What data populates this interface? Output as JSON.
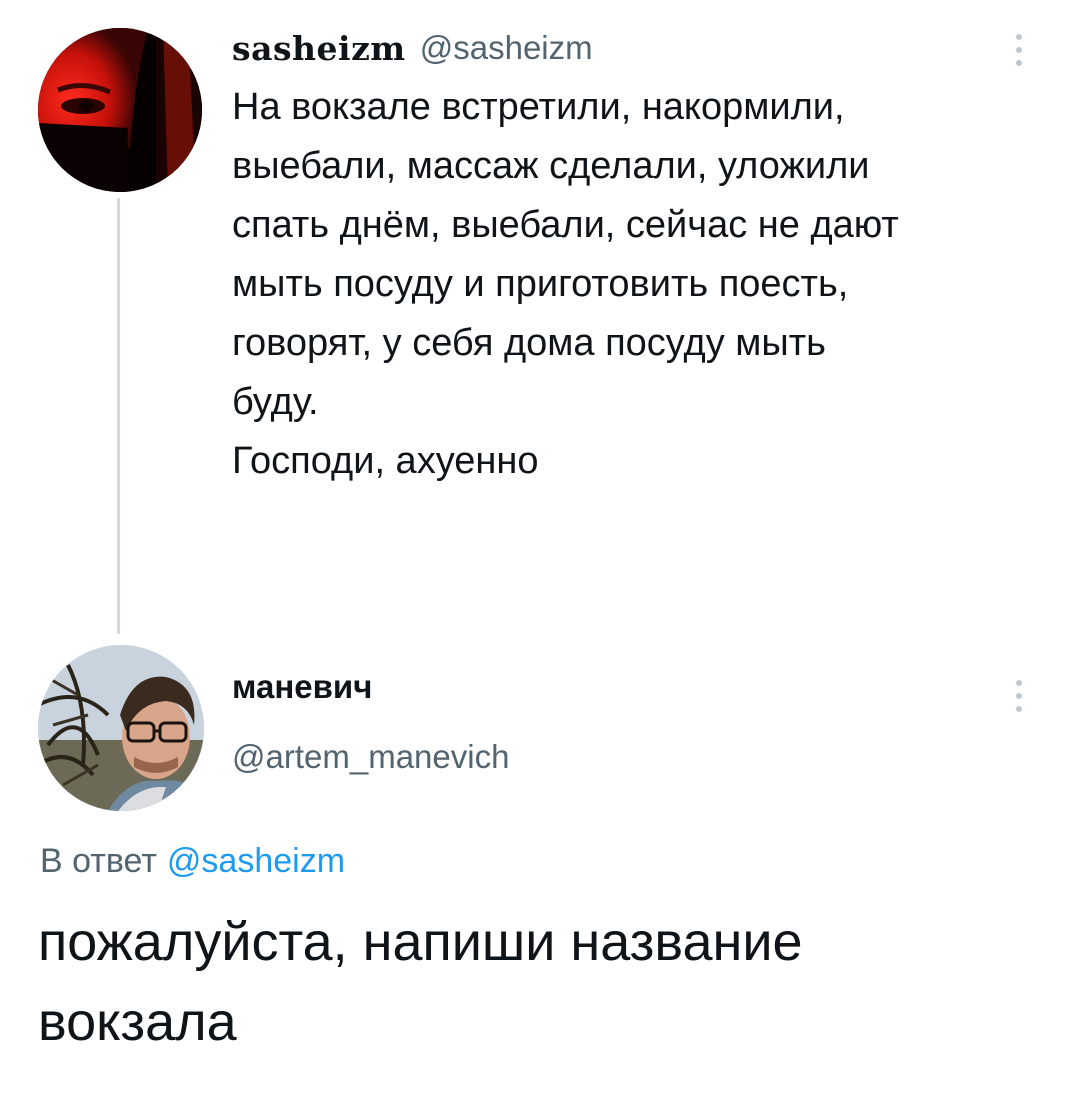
{
  "tweet": {
    "author": {
      "display_name": "sasheizm",
      "handle": "@sasheizm"
    },
    "text_lines": [
      "На вокзале встретили, накормили,",
      "выебали, массаж сделали, уложили",
      "спать днём, выебали, сейчас не дают",
      "мыть посуду и приготовить поесть,",
      "говорят, у себя дома посуду мыть",
      "буду.",
      "Господи, ахуенно"
    ],
    "more_icon": "more-vertical-icon"
  },
  "reply": {
    "author": {
      "display_name": "маневич",
      "handle": "@artem_manevich"
    },
    "reply_to_label": "В ответ",
    "reply_to_handle": "@sasheizm",
    "text_lines": [
      "пожалуйста, напиши название",
      "вокзала"
    ],
    "more_icon": "more-vertical-icon"
  },
  "colors": {
    "text_primary": "#0f1419",
    "text_secondary": "#536471",
    "link": "#1d9bf0",
    "thread_line": "#cfd9de",
    "more_dots": "#bcc7cf"
  }
}
